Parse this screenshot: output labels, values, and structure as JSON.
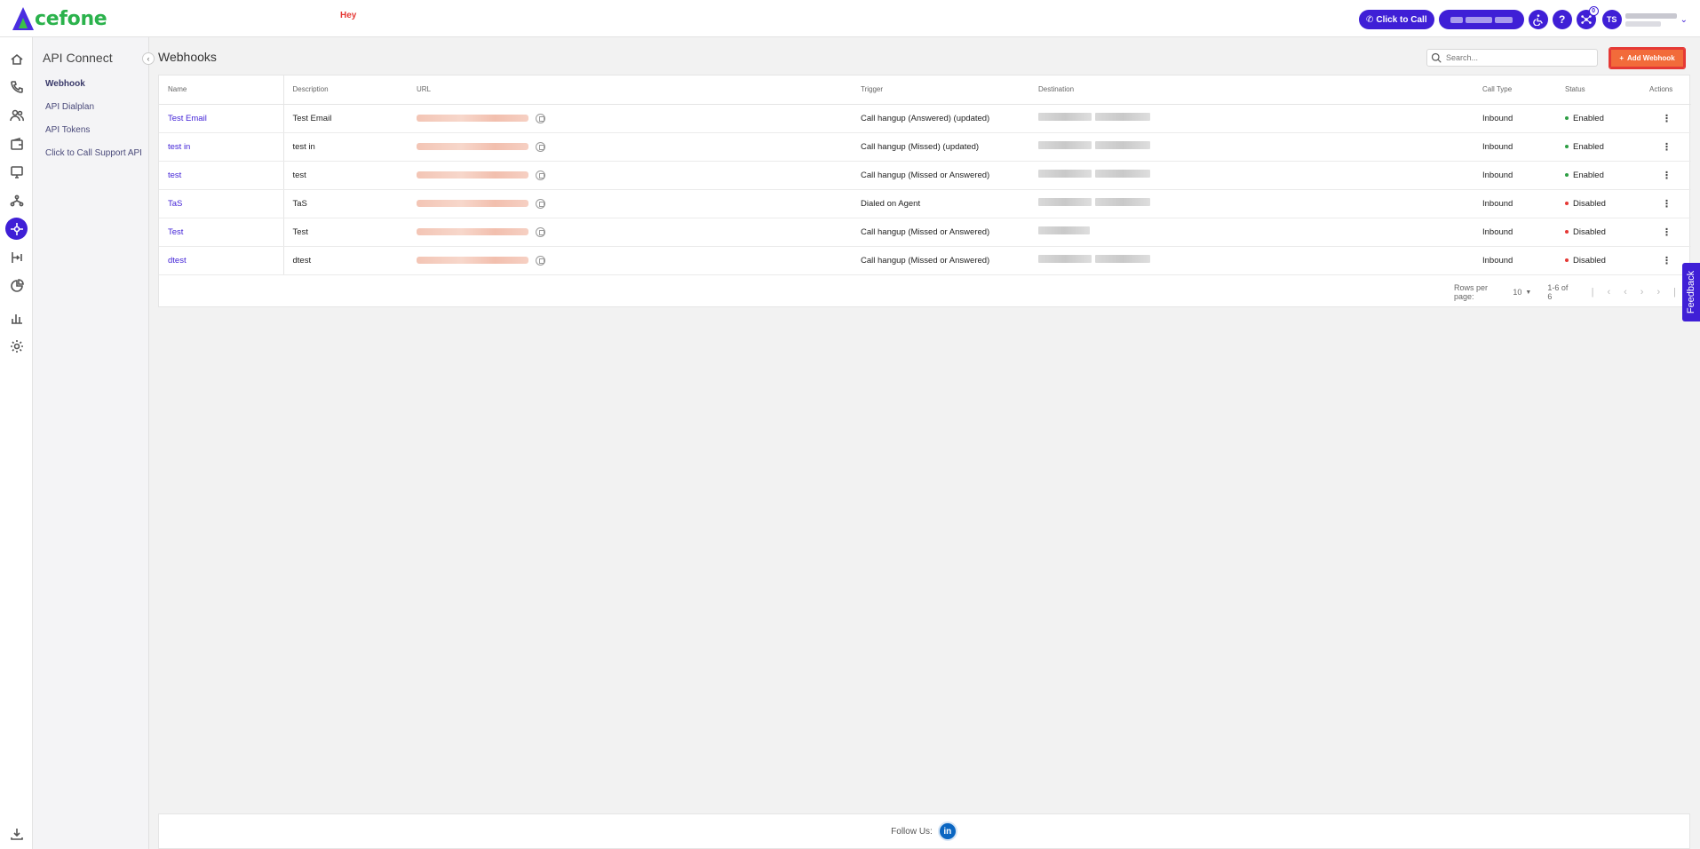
{
  "brand": {
    "logo_text": "cefone",
    "logo_letter": "A",
    "notice": "Hey"
  },
  "topbar": {
    "click_to_call": "Click to Call",
    "help_symbol": "?",
    "notification_count": "0",
    "avatar_initials": "TS"
  },
  "subnav": {
    "title": "API Connect",
    "items": [
      {
        "label": "Webhook"
      },
      {
        "label": "API Dialplan"
      },
      {
        "label": "API Tokens"
      },
      {
        "label": "Click to Call Support API"
      }
    ]
  },
  "page": {
    "title": "Webhooks",
    "search_placeholder": "Search...",
    "add_button": "Add Webhook"
  },
  "table": {
    "headers": {
      "name": "Name",
      "description": "Description",
      "url": "URL",
      "trigger": "Trigger",
      "destination": "Destination",
      "call_type": "Call Type",
      "status": "Status",
      "actions": "Actions"
    },
    "rows": [
      {
        "name": "Test Email",
        "description": "Test Email",
        "trigger": "Call hangup (Answered) (updated)",
        "call_type": "Inbound",
        "status": "Enabled"
      },
      {
        "name": "test in",
        "description": "test in",
        "trigger": "Call hangup (Missed) (updated)",
        "call_type": "Inbound",
        "status": "Enabled"
      },
      {
        "name": "test",
        "description": "test",
        "trigger": "Call hangup (Missed or Answered)",
        "call_type": "Inbound",
        "status": "Enabled"
      },
      {
        "name": "TaS",
        "description": "TaS",
        "trigger": "Dialed on Agent",
        "call_type": "Inbound",
        "status": "Disabled"
      },
      {
        "name": "Test",
        "description": "Test",
        "trigger": "Call hangup (Missed or Answered)",
        "call_type": "Inbound",
        "status": "Disabled"
      },
      {
        "name": "dtest",
        "description": "dtest",
        "trigger": "Call hangup (Missed or Answered)",
        "call_type": "Inbound",
        "status": "Disabled"
      }
    ],
    "status_colors": {
      "Enabled": "#2e9e44",
      "Disabled": "#e53935"
    }
  },
  "pagination": {
    "rows_per_page_label": "Rows per page:",
    "rows_per_page_value": "10",
    "range": "1-6 of 6"
  },
  "feedback_tab": "Feedback",
  "footer": {
    "follow_label": "Follow Us:",
    "linkedin_text": "in"
  },
  "colors": {
    "primary": "#3f1fd6",
    "accent": "#f26b3a",
    "brand_green": "#2bb24c"
  }
}
